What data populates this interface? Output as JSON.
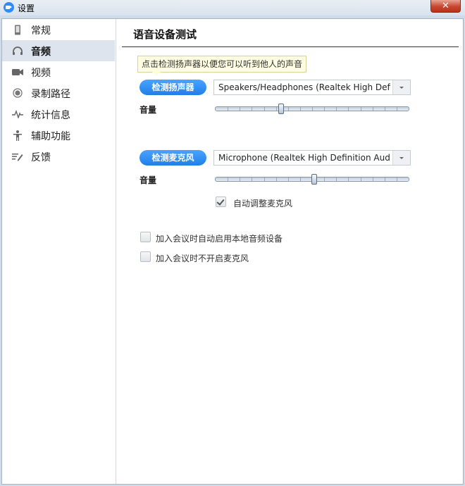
{
  "window": {
    "title": "设置",
    "close_label": "✕"
  },
  "sidebar": {
    "items": [
      {
        "label": "常规",
        "icon": "phone-icon"
      },
      {
        "label": "音频",
        "icon": "headphones-icon",
        "active": true
      },
      {
        "label": "视频",
        "icon": "video-camera-icon"
      },
      {
        "label": "录制路径",
        "icon": "record-icon"
      },
      {
        "label": "统计信息",
        "icon": "pulse-icon"
      },
      {
        "label": "辅助功能",
        "icon": "accessibility-icon"
      },
      {
        "label": "反馈",
        "icon": "feedback-icon"
      }
    ]
  },
  "panel": {
    "title": "语音设备测试",
    "tooltip": "点击检测扬声器以便您可以听到他人的声音",
    "speaker": {
      "button_label": "检测扬声器",
      "device": "Speakers/Headphones (Realtek High Definition Audio)",
      "volume_label": "音量",
      "volume_percent": 34
    },
    "microphone": {
      "button_label": "检测麦克风",
      "device": "Microphone (Realtek High Definition Audio)",
      "volume_label": "音量",
      "volume_percent": 51,
      "auto_adjust_label": "自动调整麦克风",
      "auto_adjust_checked": true
    },
    "options": [
      {
        "label": "加入会议时自动启用本地音频设备",
        "checked": false
      },
      {
        "label": "加入会议时不开启麦克风",
        "checked": false
      }
    ]
  },
  "colors": {
    "accent": "#2d8cff",
    "active_bg": "#dde4ee"
  }
}
